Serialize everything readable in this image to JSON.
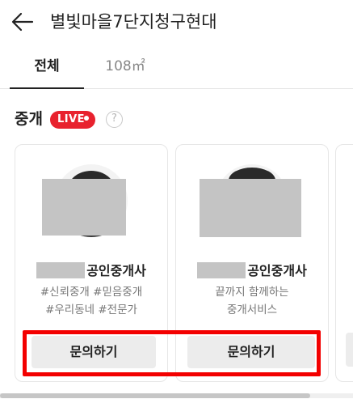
{
  "header": {
    "title": "별빛마을7단지청구현대",
    "back_icon": "arrow-left-icon"
  },
  "tabs": [
    {
      "label": "전체",
      "active": true
    },
    {
      "label": "108㎡",
      "active": false
    }
  ],
  "section": {
    "title": "중개",
    "live_badge": "LIVE",
    "help_icon": "question-circle-icon",
    "help_glyph": "?"
  },
  "agents": [
    {
      "name_suffix": "공인중개사",
      "desc_line1": "#신뢰중개 #믿음중개",
      "desc_line2": "#우리동네 #전문가",
      "button": "문의하기"
    },
    {
      "name_suffix": "공인중개사",
      "desc_line1": "끝까지 함께하는",
      "desc_line2": "중개서비스",
      "button": "문의하기"
    }
  ],
  "colors": {
    "live_red": "#e8222e",
    "highlight_red": "#f30000",
    "button_gray": "#ececec"
  }
}
